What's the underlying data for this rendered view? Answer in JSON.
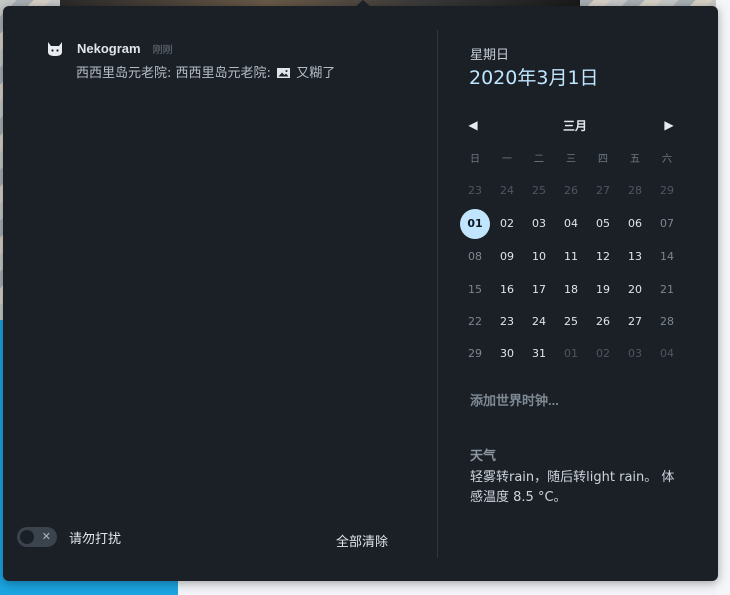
{
  "notification": {
    "app_name": "Nekogram",
    "icon": "cat-icon",
    "time": "刚刚",
    "body_prefix": "西西里岛元老院: 西西里岛元老院:",
    "body_suffix": "又糊了",
    "attachment_icon": "image-icon"
  },
  "footer": {
    "dnd_label": "请勿打扰",
    "dnd_enabled": false,
    "clear_all_label": "全部清除"
  },
  "calendar": {
    "weekday": "星期日",
    "date": "2020年3月1日",
    "month": "三月",
    "prev_icon": "triangle-left-icon",
    "next_icon": "triangle-right-icon",
    "dow": [
      "日",
      "一",
      "二",
      "三",
      "四",
      "五",
      "六"
    ],
    "weeks": [
      [
        "23",
        "24",
        "25",
        "26",
        "27",
        "28",
        "29"
      ],
      [
        "01",
        "02",
        "03",
        "04",
        "05",
        "06",
        "07"
      ],
      [
        "08",
        "09",
        "10",
        "11",
        "12",
        "13",
        "14"
      ],
      [
        "15",
        "16",
        "17",
        "18",
        "19",
        "20",
        "21"
      ],
      [
        "22",
        "23",
        "24",
        "25",
        "26",
        "27",
        "28"
      ],
      [
        "29",
        "30",
        "31",
        "01",
        "02",
        "03",
        "04"
      ]
    ],
    "selected": "01"
  },
  "world_clock": {
    "label": "添加世界时钟..."
  },
  "weather": {
    "title": "天气",
    "description": "轻雾转rain，随后转light rain。 体感温度 8.5 °C。"
  },
  "colors": {
    "panel_bg": "#1b2027",
    "accent": "#c1e5ff"
  }
}
